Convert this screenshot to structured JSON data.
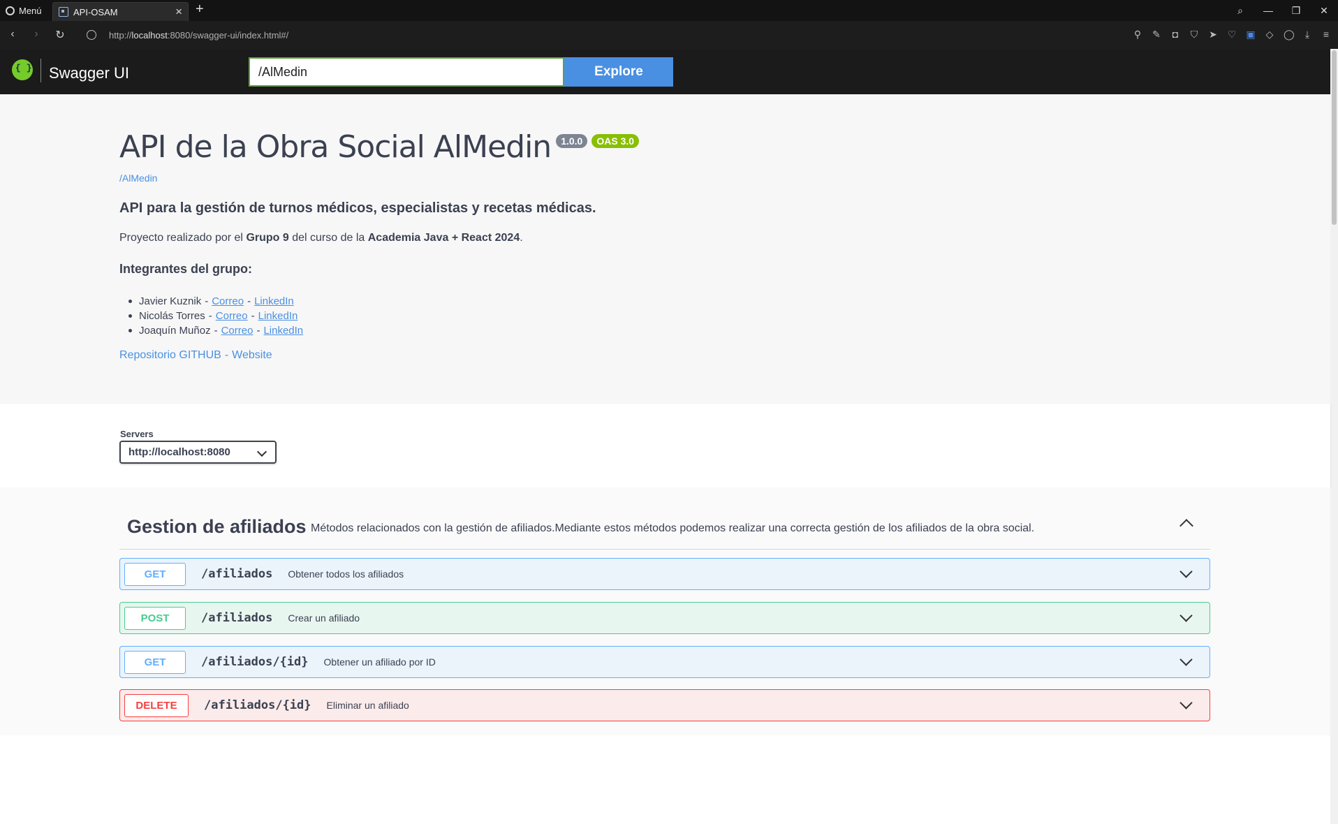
{
  "browser": {
    "menu_label": "Menú",
    "tab_title": "API-OSAM",
    "url_prefix": "http://",
    "url_host": "localhost",
    "url_rest": ":8080/swagger-ui/index.html#/"
  },
  "topbar": {
    "title": "Swagger UI",
    "search_value": "/AlMedin",
    "explore_label": "Explore"
  },
  "info": {
    "title": "API de la Obra Social AlMedin",
    "version": "1.0.0",
    "oas": "OAS 3.0",
    "base_url": "/AlMedin",
    "description_heading": "API para la gestión de turnos médicos, especialistas y recetas médicas.",
    "project_pre": "Proyecto realizado por el ",
    "project_group": "Grupo 9",
    "project_mid": " del curso de la ",
    "project_course": "Academia Java + React 2024",
    "project_end": ".",
    "team_heading": "Integrantes del grupo:",
    "members": [
      {
        "name": "Javier Kuznik",
        "email_label": "Correo",
        "linkedin_label": "LinkedIn"
      },
      {
        "name": "Nicolás Torres",
        "email_label": "Correo",
        "linkedin_label": "LinkedIn"
      },
      {
        "name": "Joaquín Muñoz",
        "email_label": "Correo",
        "linkedin_label": "LinkedIn"
      }
    ],
    "repo_label": "Repositorio GITHUB",
    "website_label": "Website"
  },
  "servers": {
    "label": "Servers",
    "selected": "http://localhost:8080"
  },
  "tag": {
    "name": "Gestion de afiliados",
    "description": "Métodos relacionados con la gestión de afiliados.Mediante estos métodos podemos realizar una correcta gestión de los afiliados de la obra social."
  },
  "operations": [
    {
      "method": "GET",
      "path": "/afiliados",
      "summary": "Obtener todos los afiliados"
    },
    {
      "method": "POST",
      "path": "/afiliados",
      "summary": "Crear un afiliado"
    },
    {
      "method": "GET",
      "path": "/afiliados/{id}",
      "summary": "Obtener un afiliado por ID"
    },
    {
      "method": "DELETE",
      "path": "/afiliados/{id}",
      "summary": "Eliminar un afiliado"
    }
  ],
  "colors": {
    "get": "#61affe",
    "post": "#49cc90",
    "delete": "#f93e3e",
    "link": "#4990e2",
    "explore": "#4990e2",
    "badge_oas": "#89bf04",
    "badge_version": "#7d8492"
  },
  "icons": [
    "opera-menu-icon",
    "tab-favicon",
    "close-icon",
    "plus-icon",
    "search-icon",
    "minimize-icon",
    "restore-icon",
    "close-window-icon",
    "back-icon",
    "forward-icon",
    "reload-icon",
    "globe-icon",
    "swagger-logo-icon",
    "chevron-down-icon",
    "chevron-up-icon"
  ]
}
